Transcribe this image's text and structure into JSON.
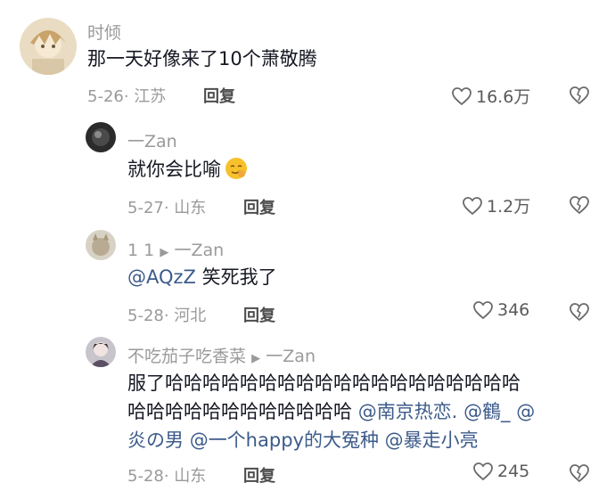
{
  "comments": [
    {
      "author": "时倾",
      "text": "那一天好像来了10个萧敬腾",
      "date_location": "5-26· 江苏",
      "reply_label": "回复",
      "likes": "16.6万"
    },
    {
      "author": "一Zan",
      "text": "就你会比喻",
      "emoji": "smirk-face-emoji",
      "date_location": "5-27· 山东",
      "reply_label": "回复",
      "likes": "1.2万"
    },
    {
      "author": "1 1",
      "reply_to": "一Zan",
      "mention": "@AQzZ",
      "text": " 笑死我了",
      "date_location": "5-28· 河北",
      "reply_label": "回复",
      "likes": "346"
    },
    {
      "author": "不吃茄子吃香菜",
      "reply_to": "一Zan",
      "text_line1": "服了哈哈哈哈哈哈哈哈哈哈哈哈哈哈哈哈哈哈哈",
      "text_line2_plain": "哈哈哈哈哈哈哈哈哈哈哈哈",
      "mention_1": "@南京热恋.",
      "mention_2": "@鶴_",
      "mention_2_cont": "@",
      "mention_3": "炎の男",
      "mention_4": "@一个happy的大冤种",
      "mention_5": "@暴走小亮",
      "date_location": "5-28· 山东",
      "reply_label": "回复",
      "likes": "245"
    }
  ],
  "colors": {
    "text": "#161823",
    "secondary": "#9a9a9a",
    "mention": "#3c5b8a"
  }
}
